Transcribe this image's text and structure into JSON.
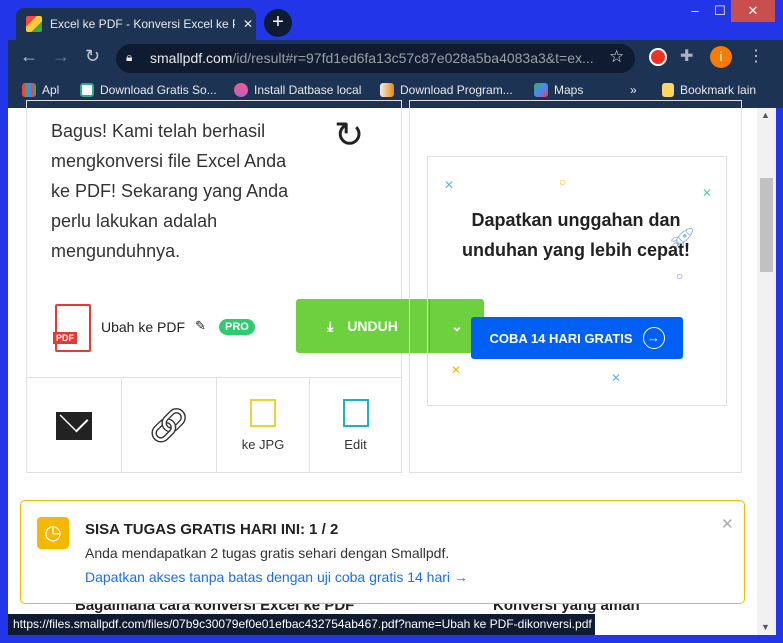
{
  "browser": {
    "tab_title": "Excel ke PDF - Konversi Excel ke PDF",
    "url_domain": "smallpdf.com",
    "url_path": "/id/result#r=97fd1ed6fa13c57c87e028a5ba4083a3&t=ex...",
    "profile_initial": "i",
    "bookmarks": [
      "Apl",
      "Download Gratis So...",
      "Install Datbase local",
      "Download Program...",
      "Maps"
    ],
    "bookmark_more": "»",
    "other_bookmarks": "Bookmark lain"
  },
  "result": {
    "message": "Bagus! Kami telah berhasil mengkonversi file Excel Anda ke PDF! Sekarang yang Anda perlu lakukan adalah mengunduhnya.",
    "file_name": "Ubah ke PDF",
    "pro_badge": "PRO",
    "download_label": "UNDUH",
    "actions": [
      {
        "label": "",
        "icon": "mail-icon"
      },
      {
        "label": "",
        "icon": "link-icon"
      },
      {
        "label": "ke JPG",
        "icon": "jpg-icon"
      },
      {
        "label": "Edit",
        "icon": "edit-icon"
      }
    ]
  },
  "promo": {
    "title": "Dapatkan unggahan dan unduhan yang lebih cepat!",
    "button": "COBA 14 HARI GRATIS"
  },
  "banner": {
    "title": "SISA TUGAS GRATIS HARI INI: 1 / 2",
    "text": "Anda mendapatkan 2 tugas gratis sehari dengan Smallpdf.",
    "link": "Dapatkan akses tanpa batas dengan uji coba gratis 14 hari →"
  },
  "below": {
    "left_heading": "Bagaimana cara konversi Excel ke PDF",
    "right_heading": "Konversi yang aman"
  },
  "status_url": "https://files.smallpdf.com/files/07b9c30079ef0e01efbac432754ab467.pdf?name=Ubah ke PDF-dikonversi.pdf",
  "colors": {
    "accent_green": "#6cd03f",
    "accent_blue": "#0060f5",
    "warning": "#f5b800"
  }
}
